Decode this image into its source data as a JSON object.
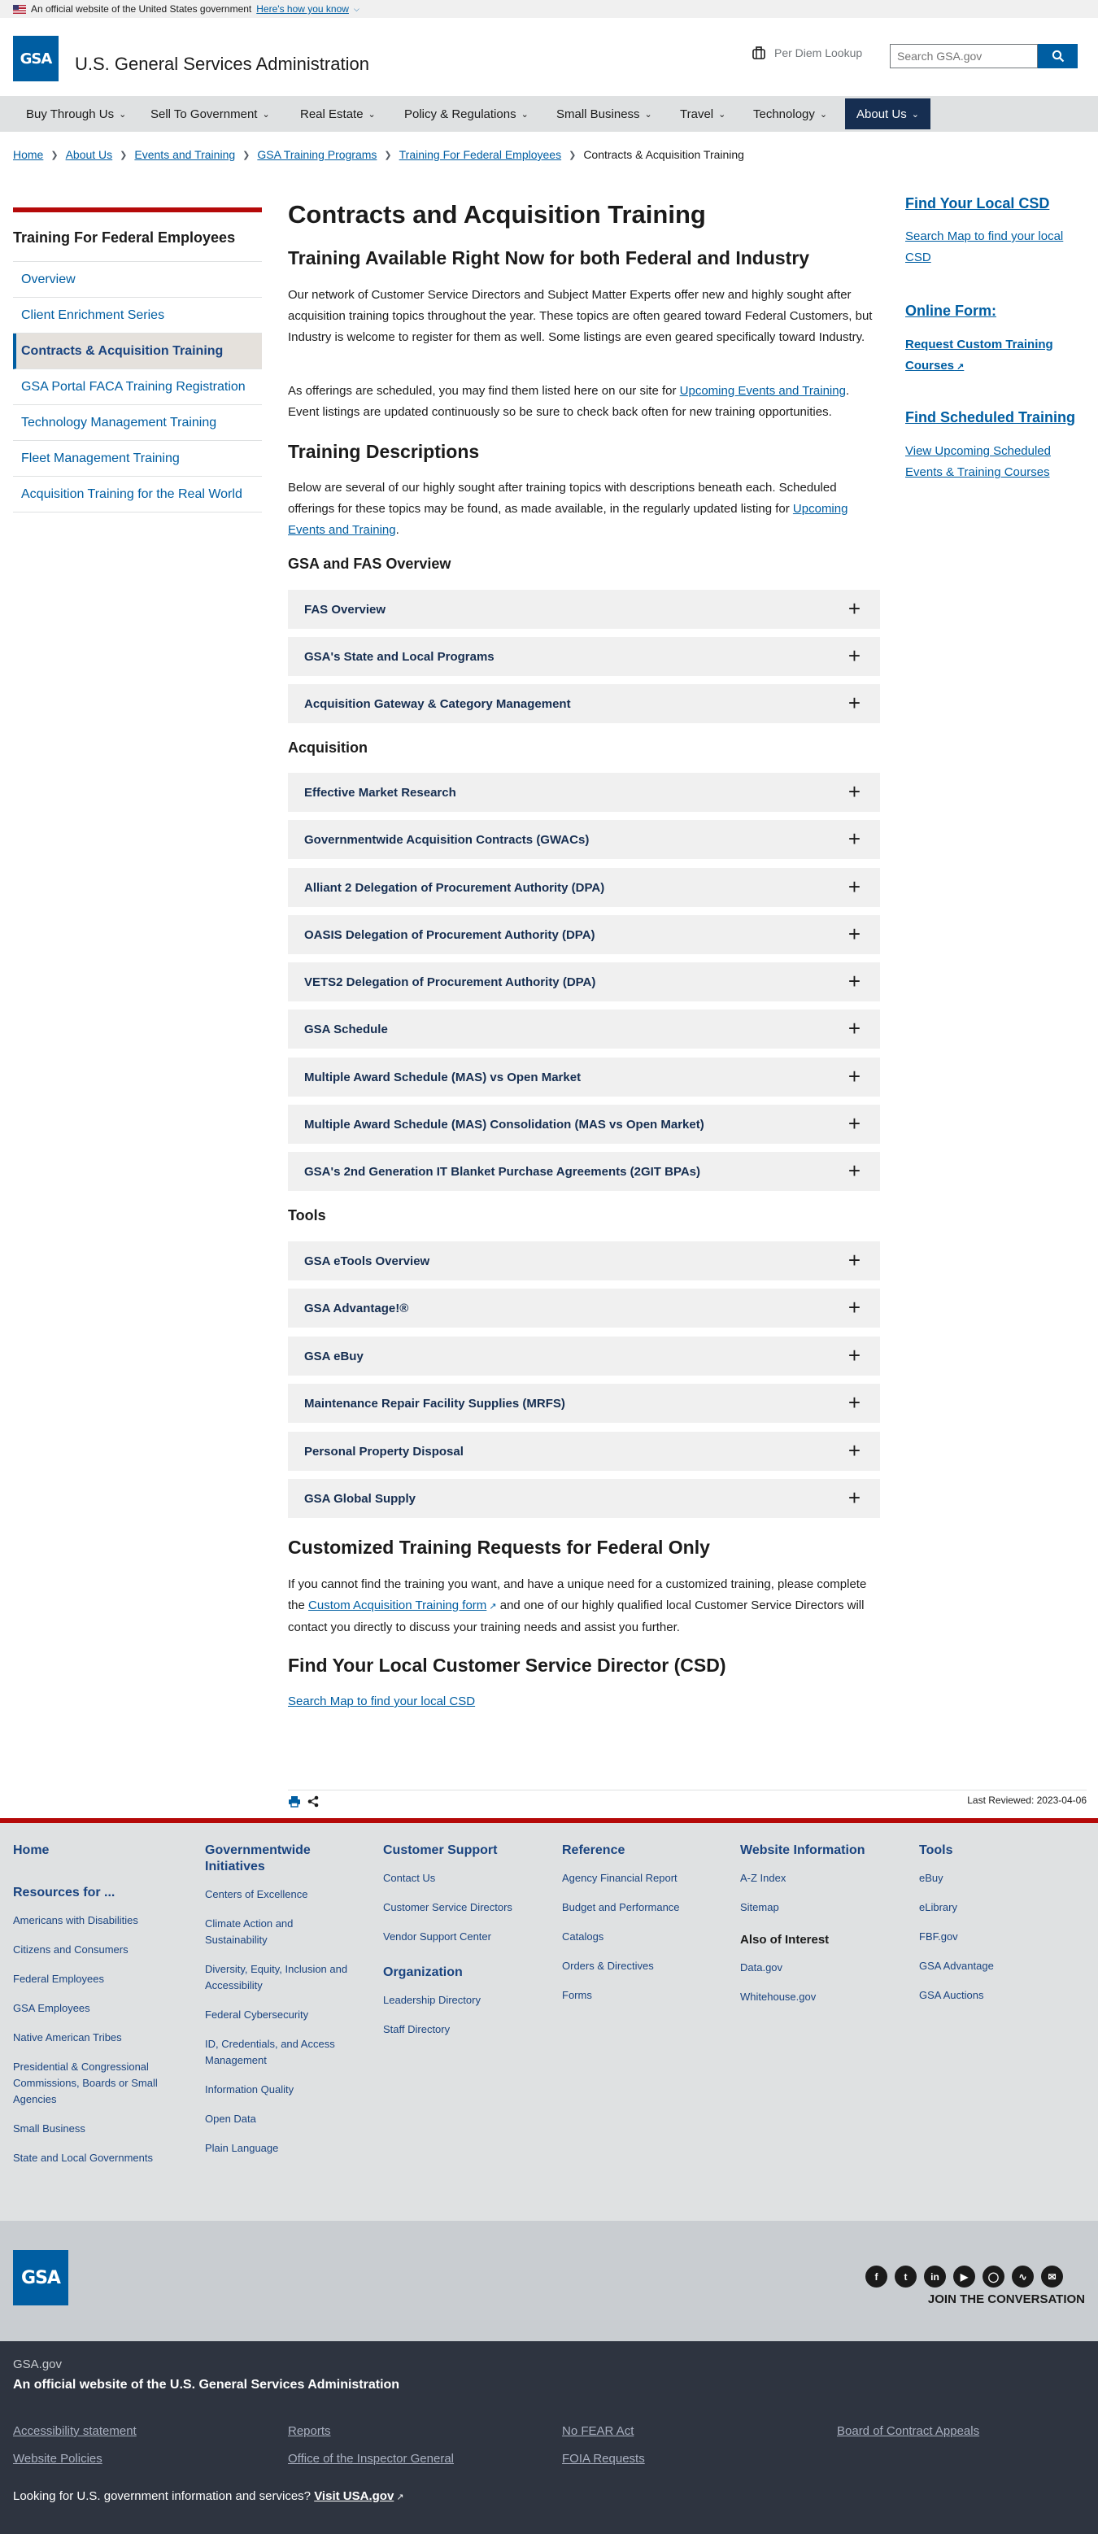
{
  "gov_banner": {
    "text": "An official website of the United States government",
    "link": "Here's how you know"
  },
  "header": {
    "site_title": "U.S. General Services Administration",
    "logo_text": "GSA",
    "per_diem": "Per Diem Lookup",
    "search_placeholder": "Search GSA.gov"
  },
  "nav": [
    {
      "label": "Buy Through Us"
    },
    {
      "label": "Sell To Government"
    },
    {
      "label": "Real Estate"
    },
    {
      "label": "Policy & Regulations"
    },
    {
      "label": "Small Business"
    },
    {
      "label": "Travel"
    },
    {
      "label": "Technology"
    },
    {
      "label": "About Us"
    }
  ],
  "breadcrumb": [
    "Home",
    "About Us",
    "Events and Training",
    "GSA Training Programs",
    "Training For Federal Employees",
    "Contracts & Acquisition Training"
  ],
  "sidenav": {
    "title": "Training For Federal Employees",
    "items": [
      "Overview",
      "Client Enrichment Series",
      "Contracts & Acquisition Training",
      "GSA Portal FACA Training Registration",
      "Technology Management Training",
      "Fleet Management Training",
      "Acquisition Training for the Real World"
    ]
  },
  "main": {
    "title": "Contracts and Acquisition Training",
    "subtitle": "Training Available Right Now for both Federal and Industry",
    "p1": "Our network of Customer Service Directors and Subject Matter Experts offer new and highly sought after acquisition training topics throughout the year. These topics are often geared toward Federal Customers, but Industry is welcome to register for them as well. Some listings are even geared specifically toward Industry.",
    "p2_before": "As offerings are scheduled, you may find them listed here on our site for ",
    "p2_link": "Upcoming Events and Training",
    "p2_after": ". Event listings are updated continuously so be sure to check back often for new training opportunities.",
    "descriptions_title": "Training Descriptions",
    "p3_before": "Below are several of our highly sought after training topics with descriptions beneath each. Scheduled offerings for these topics may be found, as made available, in the regularly updated listing for ",
    "p3_link": "Upcoming Events and Training",
    "p3_after": ".",
    "sections": [
      {
        "title": "GSA and FAS Overview",
        "items": [
          "FAS Overview",
          "GSA's State and Local Programs",
          "Acquisition Gateway & Category Management"
        ]
      },
      {
        "title": "Acquisition",
        "items": [
          "Effective Market Research",
          "Governmentwide Acquisition Contracts (GWACs)",
          "Alliant 2 Delegation of Procurement Authority (DPA)",
          "OASIS Delegation of Procurement Authority (DPA)",
          "VETS2 Delegation of Procurement Authority (DPA)",
          "GSA Schedule",
          "Multiple Award Schedule (MAS) vs Open Market",
          "Multiple Award Schedule (MAS) Consolidation (MAS vs Open Market)",
          "GSA's 2nd Generation IT Blanket Purchase Agreements (2GIT BPAs)"
        ]
      },
      {
        "title": "Tools",
        "items": [
          "GSA eTools Overview",
          "GSA Advantage!®",
          "GSA eBuy",
          "Maintenance Repair Facility Supplies (MRFS)",
          "Personal Property Disposal",
          "GSA Global Supply"
        ]
      }
    ],
    "custom_title": "Customized Training Requests for Federal Only",
    "custom_before": "If you cannot find the training you want, and have a unique need for a customized training, please complete the ",
    "custom_link": "Custom Acquisition Training form",
    "custom_after": " and one of our highly qualified local Customer Service Directors will contact you directly to discuss your training needs and assist you further.",
    "csd_title": "Find Your Local Customer Service Director (CSD)",
    "csd_link": "Search Map to find your local CSD",
    "last_reviewed": "Last Reviewed: 2023-04-06"
  },
  "right_sidebar": [
    {
      "title": "Find Your Local CSD",
      "link": "Search Map to find your local CSD"
    },
    {
      "title": "Online Form:",
      "link": "Request Custom Training Courses",
      "bold": true
    },
    {
      "title": "Find Scheduled Training",
      "link": "View Upcoming Scheduled Events & Training Courses"
    }
  ],
  "footer": {
    "col1": {
      "home": "Home",
      "resources": "Resources for ...",
      "links": [
        "Americans with Disabilities",
        "Citizens and Consumers",
        "Federal Employees",
        "GSA Employees",
        "Native American Tribes",
        "Presidential & Congressional Commissions, Boards or Small Agencies",
        "Small Business",
        "State and Local Governments"
      ]
    },
    "col2": {
      "title": "Governmentwide Initiatives",
      "links": [
        "Centers of Excellence",
        "Climate Action and Sustainability",
        "Diversity, Equity, Inclusion and Accessibility",
        "Federal Cybersecurity",
        "ID, Credentials, and Access Management",
        "Information Quality",
        "Open Data",
        "Plain Language"
      ]
    },
    "col3": {
      "title": "Customer Support",
      "links": [
        "Contact Us",
        "Customer Service Directors",
        "Vendor Support Center"
      ],
      "title2": "Organization",
      "links2": [
        "Leadership Directory",
        "Staff Directory"
      ]
    },
    "col4": {
      "title": "Reference",
      "links": [
        "Agency Financial Report",
        "Budget and Performance",
        "Catalogs",
        "Orders & Directives",
        "Forms"
      ]
    },
    "col5": {
      "title": "Website Information",
      "links": [
        "A-Z Index",
        "Sitemap"
      ],
      "title2": "Also of Interest",
      "links2": [
        "Data.gov",
        "Whitehouse.gov"
      ]
    },
    "col6": {
      "title": "Tools",
      "links": [
        "eBuy",
        "eLibrary",
        "FBF.gov",
        "GSA Advantage",
        "GSA Auctions"
      ]
    },
    "join": "JOIN THE CONVERSATION",
    "social_icons": [
      "facebook-icon",
      "twitter-icon",
      "linkedin-icon",
      "youtube-icon",
      "instagram-icon",
      "rss-icon",
      "email-icon"
    ]
  },
  "identifier": {
    "domain": "GSA.gov",
    "official": "An official website of the U.S. General Services Administration",
    "links": [
      "Accessibility statement",
      "Reports",
      "No FEAR Act",
      "Board of Contract Appeals",
      "Website Policies",
      "Office of the Inspector General",
      "FOIA Requests"
    ],
    "usa_before": "Looking for U.S. government information and services?",
    "usa_link": "Visit USA.gov"
  }
}
